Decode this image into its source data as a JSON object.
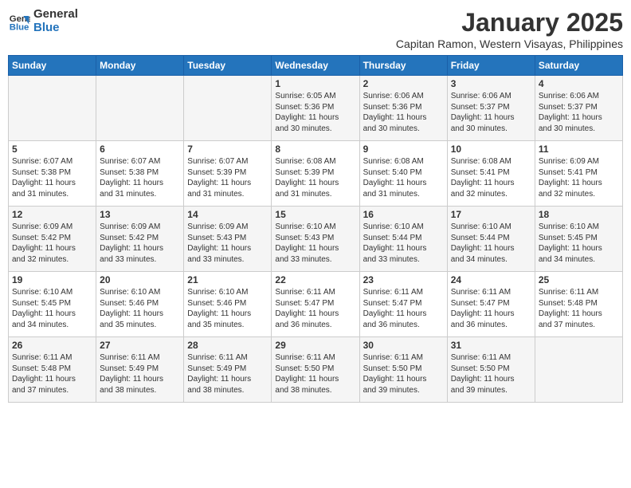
{
  "logo": {
    "line1": "General",
    "line2": "Blue"
  },
  "title": "January 2025",
  "subtitle": "Capitan Ramon, Western Visayas, Philippines",
  "headers": [
    "Sunday",
    "Monday",
    "Tuesday",
    "Wednesday",
    "Thursday",
    "Friday",
    "Saturday"
  ],
  "weeks": [
    [
      {
        "day": "",
        "info": ""
      },
      {
        "day": "",
        "info": ""
      },
      {
        "day": "",
        "info": ""
      },
      {
        "day": "1",
        "info": "Sunrise: 6:05 AM\nSunset: 5:36 PM\nDaylight: 11 hours\nand 30 minutes."
      },
      {
        "day": "2",
        "info": "Sunrise: 6:06 AM\nSunset: 5:36 PM\nDaylight: 11 hours\nand 30 minutes."
      },
      {
        "day": "3",
        "info": "Sunrise: 6:06 AM\nSunset: 5:37 PM\nDaylight: 11 hours\nand 30 minutes."
      },
      {
        "day": "4",
        "info": "Sunrise: 6:06 AM\nSunset: 5:37 PM\nDaylight: 11 hours\nand 30 minutes."
      }
    ],
    [
      {
        "day": "5",
        "info": "Sunrise: 6:07 AM\nSunset: 5:38 PM\nDaylight: 11 hours\nand 31 minutes."
      },
      {
        "day": "6",
        "info": "Sunrise: 6:07 AM\nSunset: 5:38 PM\nDaylight: 11 hours\nand 31 minutes."
      },
      {
        "day": "7",
        "info": "Sunrise: 6:07 AM\nSunset: 5:39 PM\nDaylight: 11 hours\nand 31 minutes."
      },
      {
        "day": "8",
        "info": "Sunrise: 6:08 AM\nSunset: 5:39 PM\nDaylight: 11 hours\nand 31 minutes."
      },
      {
        "day": "9",
        "info": "Sunrise: 6:08 AM\nSunset: 5:40 PM\nDaylight: 11 hours\nand 31 minutes."
      },
      {
        "day": "10",
        "info": "Sunrise: 6:08 AM\nSunset: 5:41 PM\nDaylight: 11 hours\nand 32 minutes."
      },
      {
        "day": "11",
        "info": "Sunrise: 6:09 AM\nSunset: 5:41 PM\nDaylight: 11 hours\nand 32 minutes."
      }
    ],
    [
      {
        "day": "12",
        "info": "Sunrise: 6:09 AM\nSunset: 5:42 PM\nDaylight: 11 hours\nand 32 minutes."
      },
      {
        "day": "13",
        "info": "Sunrise: 6:09 AM\nSunset: 5:42 PM\nDaylight: 11 hours\nand 33 minutes."
      },
      {
        "day": "14",
        "info": "Sunrise: 6:09 AM\nSunset: 5:43 PM\nDaylight: 11 hours\nand 33 minutes."
      },
      {
        "day": "15",
        "info": "Sunrise: 6:10 AM\nSunset: 5:43 PM\nDaylight: 11 hours\nand 33 minutes."
      },
      {
        "day": "16",
        "info": "Sunrise: 6:10 AM\nSunset: 5:44 PM\nDaylight: 11 hours\nand 33 minutes."
      },
      {
        "day": "17",
        "info": "Sunrise: 6:10 AM\nSunset: 5:44 PM\nDaylight: 11 hours\nand 34 minutes."
      },
      {
        "day": "18",
        "info": "Sunrise: 6:10 AM\nSunset: 5:45 PM\nDaylight: 11 hours\nand 34 minutes."
      }
    ],
    [
      {
        "day": "19",
        "info": "Sunrise: 6:10 AM\nSunset: 5:45 PM\nDaylight: 11 hours\nand 34 minutes."
      },
      {
        "day": "20",
        "info": "Sunrise: 6:10 AM\nSunset: 5:46 PM\nDaylight: 11 hours\nand 35 minutes."
      },
      {
        "day": "21",
        "info": "Sunrise: 6:10 AM\nSunset: 5:46 PM\nDaylight: 11 hours\nand 35 minutes."
      },
      {
        "day": "22",
        "info": "Sunrise: 6:11 AM\nSunset: 5:47 PM\nDaylight: 11 hours\nand 36 minutes."
      },
      {
        "day": "23",
        "info": "Sunrise: 6:11 AM\nSunset: 5:47 PM\nDaylight: 11 hours\nand 36 minutes."
      },
      {
        "day": "24",
        "info": "Sunrise: 6:11 AM\nSunset: 5:47 PM\nDaylight: 11 hours\nand 36 minutes."
      },
      {
        "day": "25",
        "info": "Sunrise: 6:11 AM\nSunset: 5:48 PM\nDaylight: 11 hours\nand 37 minutes."
      }
    ],
    [
      {
        "day": "26",
        "info": "Sunrise: 6:11 AM\nSunset: 5:48 PM\nDaylight: 11 hours\nand 37 minutes."
      },
      {
        "day": "27",
        "info": "Sunrise: 6:11 AM\nSunset: 5:49 PM\nDaylight: 11 hours\nand 38 minutes."
      },
      {
        "day": "28",
        "info": "Sunrise: 6:11 AM\nSunset: 5:49 PM\nDaylight: 11 hours\nand 38 minutes."
      },
      {
        "day": "29",
        "info": "Sunrise: 6:11 AM\nSunset: 5:50 PM\nDaylight: 11 hours\nand 38 minutes."
      },
      {
        "day": "30",
        "info": "Sunrise: 6:11 AM\nSunset: 5:50 PM\nDaylight: 11 hours\nand 39 minutes."
      },
      {
        "day": "31",
        "info": "Sunrise: 6:11 AM\nSunset: 5:50 PM\nDaylight: 11 hours\nand 39 minutes."
      },
      {
        "day": "",
        "info": ""
      }
    ]
  ]
}
